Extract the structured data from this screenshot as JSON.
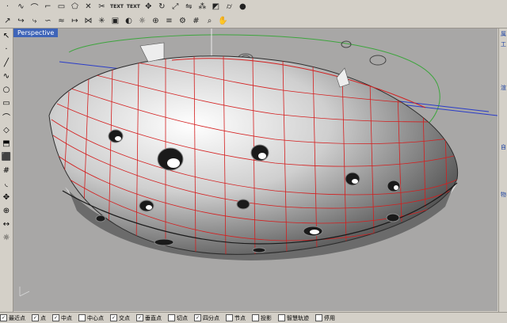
{
  "toolbar_top": {
    "row1": [
      "point-icon",
      "curve-icon",
      "arc-icon",
      "rect-icon",
      "polygon-icon",
      "text-icon",
      "text-icon",
      "text-icon",
      "select-icon",
      "move-icon",
      "rotate-icon",
      "scale-icon",
      "box-icon",
      "sphere-icon",
      "render-icon"
    ],
    "text_a": "TEXT",
    "text_b": "TEXT"
  },
  "viewport": {
    "label": "Perspective",
    "background": "#a8a7a6",
    "isocurve_color": "#d41f1f"
  },
  "right_panel": {
    "labels": [
      "属",
      "工",
      "渲",
      "自",
      "物"
    ]
  },
  "status_bar": {
    "snaps": [
      {
        "label": "最近点",
        "checked": true
      },
      {
        "label": "点",
        "checked": true
      },
      {
        "label": "中点",
        "checked": true
      },
      {
        "label": "中心点",
        "checked": false
      },
      {
        "label": "交点",
        "checked": true
      },
      {
        "label": "垂直点",
        "checked": true
      },
      {
        "label": "切点",
        "checked": false
      },
      {
        "label": "四分点",
        "checked": true
      },
      {
        "label": "节点",
        "checked": false
      },
      {
        "label": "投影",
        "checked": false
      },
      {
        "label": "智慧轨迹",
        "checked": false
      },
      {
        "label": "停用",
        "checked": false
      }
    ]
  }
}
